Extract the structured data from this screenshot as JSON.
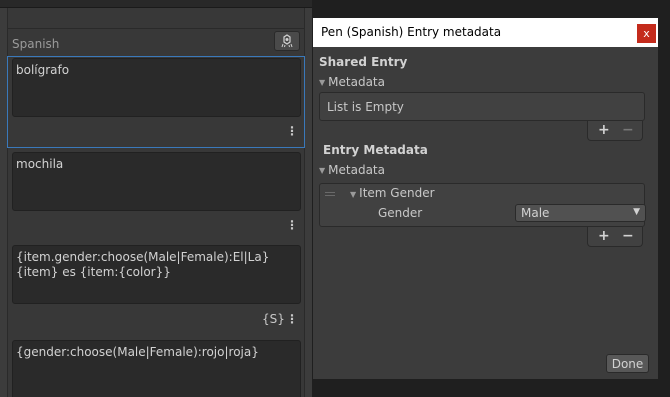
{
  "column": {
    "title": "Spanish"
  },
  "entries": [
    {
      "text": "bolígrafo",
      "smart_tag": ""
    },
    {
      "text": "mochila",
      "smart_tag": ""
    },
    {
      "text": "{item.gender:choose(Male|Female):El|La} {item} es {item:{color}}",
      "smart_tag": "{S}"
    },
    {
      "text": "{gender:choose(Male|Female):rojo|roja}",
      "smart_tag": ""
    }
  ],
  "metadata_window": {
    "title": "Pen (Spanish) Entry metadata",
    "close_label": "x",
    "shared_entry": {
      "heading": "Shared Entry",
      "foldout_label": "Metadata",
      "empty_text": "List is Empty",
      "add_label": "+",
      "remove_label": "−"
    },
    "entry_metadata": {
      "heading": "Entry Metadata",
      "foldout_label": "Metadata",
      "item_label": "Item Gender",
      "field_label": "Gender",
      "field_value": "Male",
      "add_label": "+",
      "remove_label": "−"
    },
    "done_label": "Done"
  },
  "icons": {
    "metadata_button": "metadata-icon",
    "kebab": "more-options-icon",
    "foldout": "triangle-down-icon",
    "dropdown": "chevron-down-icon",
    "drag_handle": "drag-handle-icon"
  },
  "colors": {
    "selection_border": "#3a79bb",
    "close_button": "#c42b1c",
    "window_bg": "#3c3c3c"
  }
}
